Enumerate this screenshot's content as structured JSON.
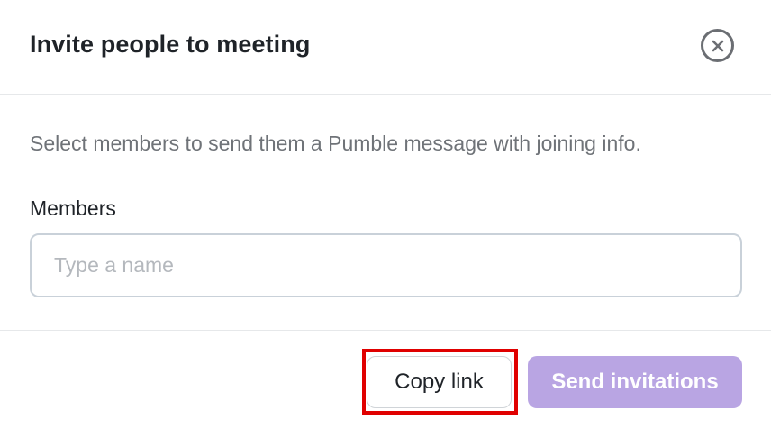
{
  "dialog": {
    "title": "Invite people to meeting",
    "close_icon": "close-circle-icon"
  },
  "body": {
    "description": "Select members to send them a Pumble message with joining info.",
    "members_label": "Members",
    "members_input": {
      "value": "",
      "placeholder": "Type a name"
    }
  },
  "footer": {
    "copy_link_label": "Copy link",
    "send_invitations_label": "Send invitations",
    "send_invitations_disabled": true
  },
  "colors": {
    "title_text": "#1f2328",
    "description_text": "#6f7378",
    "placeholder_text": "#b4b8bd",
    "send_button_bg_disabled": "#b9a5e3",
    "highlight_outline": "#e00000"
  }
}
